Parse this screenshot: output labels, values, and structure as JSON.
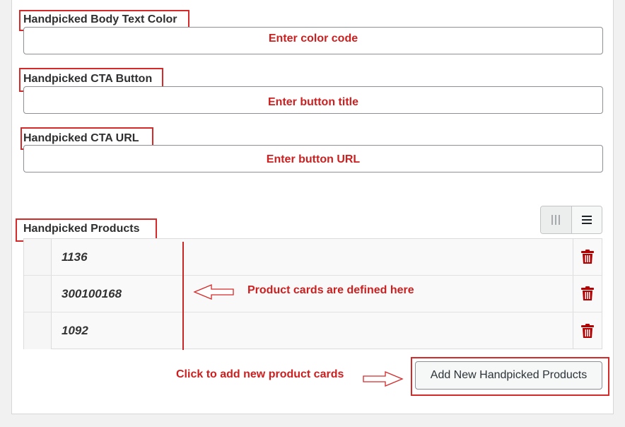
{
  "fields": [
    {
      "label": "Handpicked Body Text Color",
      "hint": "Enter color code"
    },
    {
      "label": "Handpicked CTA Button",
      "hint": "Enter button title"
    },
    {
      "label": "Handpicked CTA URL",
      "hint": "Enter button URL"
    }
  ],
  "products": {
    "label": "Handpicked Products",
    "view_toggle": {
      "grid_icon": "grid-view-icon",
      "list_icon": "list-view-icon",
      "active": "list"
    },
    "rows": [
      {
        "id": "1136",
        "delete_icon": "trash-icon"
      },
      {
        "id": "300100168",
        "delete_icon": "trash-icon"
      },
      {
        "id": "1092",
        "delete_icon": "trash-icon"
      }
    ],
    "annotation": "Product cards are defined here",
    "add_annotation": "Click to add new product cards",
    "add_button_label": "Add New Handpicked Products"
  },
  "colors": {
    "annotation_red": "#cc1f1f",
    "trash_red": "#b30000"
  }
}
